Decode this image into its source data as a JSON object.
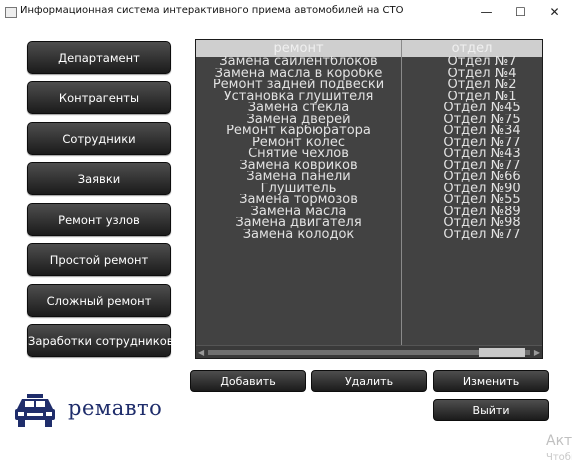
{
  "window": {
    "title": "Информационная система интерактивного приема автомобилей на СТО",
    "minimize": "—",
    "maximize": "☐",
    "close": "✕"
  },
  "nav": [
    {
      "label": "Департамент"
    },
    {
      "label": "Контрагенты"
    },
    {
      "label": "Сотрудники"
    },
    {
      "label": "Заявки"
    },
    {
      "label": "Ремонт узлов"
    },
    {
      "label": "Простой ремонт"
    },
    {
      "label": "Сложный ремонт"
    },
    {
      "label": "Заработки сотрудников"
    }
  ],
  "table": {
    "columns": [
      "ремонт",
      "отдел"
    ],
    "rows": [
      [
        "Замена сайлентблоков",
        "Отдел №7"
      ],
      [
        "Замена масла в коробке",
        "Отдел №4"
      ],
      [
        "Ремонт задней подвески",
        "Отдел №2"
      ],
      [
        "Установка глушителя",
        "Отдел №1"
      ],
      [
        "Замена стекла",
        "Отдел №45"
      ],
      [
        "Замена дверей",
        "Отдел №75"
      ],
      [
        "Ремонт карбюратора",
        "Отдел №34"
      ],
      [
        "Ремонт колес",
        "Отдел №77"
      ],
      [
        "Снятие чехлов",
        "Отдел №43"
      ],
      [
        "Замена ковриков",
        "Отдел №77"
      ],
      [
        "Замена панели",
        "Отдел №66"
      ],
      [
        "Глушитель",
        "Отдел №90"
      ],
      [
        "Замена тормозов",
        "Отдел №55"
      ],
      [
        "Замена масла",
        "Отдел №89"
      ],
      [
        "Замена двигателя",
        "Отдел №98"
      ],
      [
        "Замена колодок",
        "Отдел №77"
      ]
    ]
  },
  "actions": {
    "add": "Добавить",
    "delete": "Удалить",
    "edit": "Изменить",
    "exit": "Выйти"
  },
  "logo": {
    "text": "ремавто"
  },
  "watermark": {
    "line1": "Акти",
    "line2": "Чтобы"
  }
}
